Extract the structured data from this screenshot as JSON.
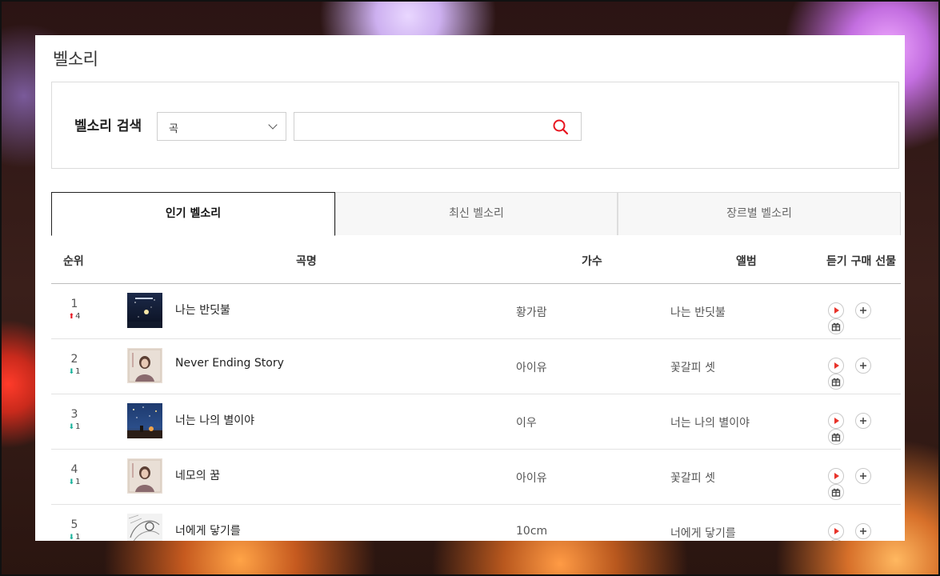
{
  "page": {
    "title": "벨소리"
  },
  "search": {
    "label": "벨소리 검색",
    "select_value": "곡",
    "input_value": "",
    "input_placeholder": ""
  },
  "tabs": [
    {
      "label": "인기 벨소리",
      "active": true
    },
    {
      "label": "최신 벨소리",
      "active": false
    },
    {
      "label": "장르별 벨소리",
      "active": false
    }
  ],
  "table": {
    "headers": {
      "rank": "순위",
      "song": "곡명",
      "artist": "가수",
      "album": "앨범",
      "actions": "듣기 구매 선물"
    },
    "rows": [
      {
        "rank": "1",
        "change": "4",
        "direction": "up",
        "song": "나는 반딧불",
        "artist": "황가람",
        "album": "나는 반딧불",
        "cover": "night-sky-cover"
      },
      {
        "rank": "2",
        "change": "1",
        "direction": "down",
        "song": "Never Ending Story",
        "artist": "아이유",
        "album": "꽃갈피 셋",
        "cover": "portrait-cover"
      },
      {
        "rank": "3",
        "change": "1",
        "direction": "down",
        "song": "너는 나의 별이야",
        "artist": "이우",
        "album": "너는 나의 별이야",
        "cover": "starry-night-cover"
      },
      {
        "rank": "4",
        "change": "1",
        "direction": "down",
        "song": "네모의 꿈",
        "artist": "아이유",
        "album": "꽃갈피 셋",
        "cover": "portrait-cover"
      },
      {
        "rank": "5",
        "change": "1",
        "direction": "down",
        "song": "너에게 닿기를",
        "artist": "10cm",
        "album": "너에게 닿기를",
        "cover": "sketch-cover"
      }
    ]
  },
  "colors": {
    "up_arrow": "#e8141f",
    "down_arrow": "#18b29b",
    "play_icon": "#e8332a",
    "search_icon": "#e8141f"
  }
}
